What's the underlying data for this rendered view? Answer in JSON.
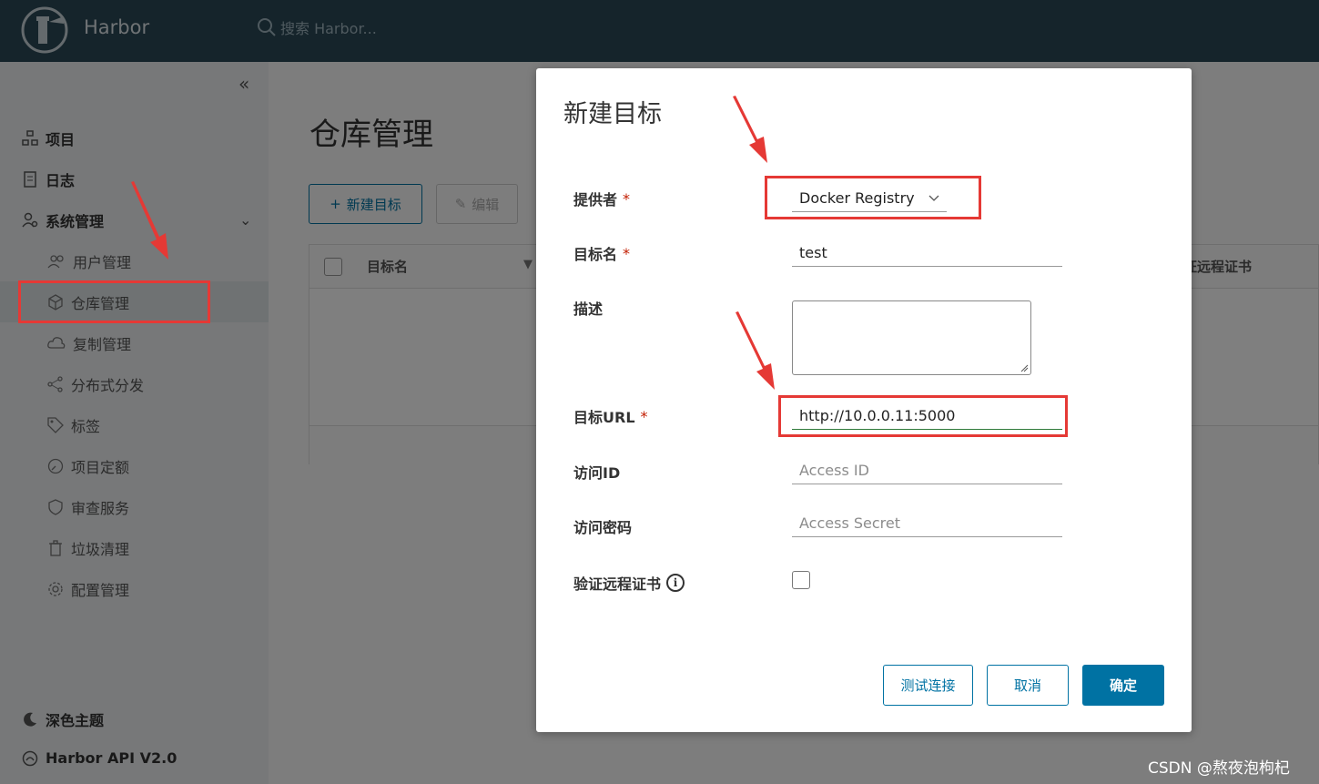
{
  "header": {
    "brand": "Harbor",
    "search_placeholder": "搜索 Harbor..."
  },
  "sidebar": {
    "items": [
      {
        "label": "项目",
        "icon": "projects-icon"
      },
      {
        "label": "日志",
        "icon": "logs-icon"
      },
      {
        "label": "系统管理",
        "icon": "admin-icon"
      }
    ],
    "sub_items": [
      {
        "label": "用户管理",
        "icon": "users-icon"
      },
      {
        "label": "仓库管理",
        "icon": "registry-icon",
        "active": true
      },
      {
        "label": "复制管理",
        "icon": "replication-icon"
      },
      {
        "label": "分布式分发",
        "icon": "distribution-icon"
      },
      {
        "label": "标签",
        "icon": "tag-icon"
      },
      {
        "label": "项目定额",
        "icon": "quota-icon"
      },
      {
        "label": "审查服务",
        "icon": "shield-icon"
      },
      {
        "label": "垃圾清理",
        "icon": "trash-icon"
      },
      {
        "label": "配置管理",
        "icon": "gear-icon"
      }
    ],
    "footer": [
      {
        "label": "深色主题",
        "icon": "moon-icon"
      },
      {
        "label": "Harbor API V2.0",
        "icon": "api-icon"
      }
    ]
  },
  "main": {
    "title": "仓库管理",
    "new_button": "新建目标",
    "edit_button": "编辑",
    "col_name": "目标名",
    "col_cert": "证远程证书"
  },
  "modal": {
    "title": "新建目标",
    "fields": {
      "provider": {
        "label": "提供者",
        "value": "Docker Registry"
      },
      "name": {
        "label": "目标名",
        "value": "test"
      },
      "description": {
        "label": "描述",
        "value": ""
      },
      "url": {
        "label": "目标URL",
        "value": "http://10.0.0.11:5000"
      },
      "access_id": {
        "label": "访问ID",
        "placeholder": "Access ID"
      },
      "access_secret": {
        "label": "访问密码",
        "placeholder": "Access Secret"
      },
      "verify_cert": {
        "label": "验证远程证书",
        "checked": false
      }
    },
    "required_mark": "*",
    "buttons": {
      "test": "测试连接",
      "cancel": "取消",
      "ok": "确定"
    }
  },
  "watermark": "CSDN @熬夜泡枸杞",
  "colors": {
    "accent": "#0072a3",
    "header": "#2a4856",
    "annotation": "#e53935"
  }
}
